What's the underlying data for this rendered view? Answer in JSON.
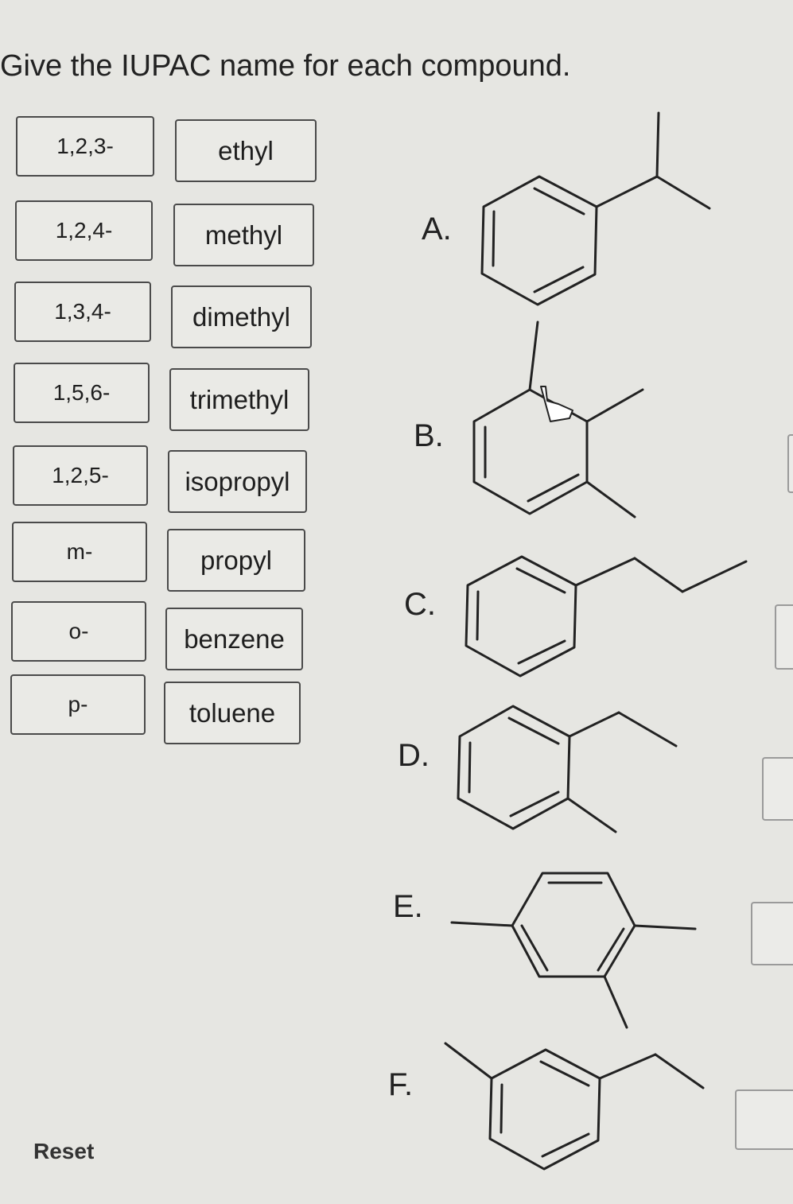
{
  "question": "Give the IUPAC name for each compound.",
  "prefix_tiles": [
    "1,2,3-",
    "1,2,4-",
    "1,3,4-",
    "1,5,6-",
    "1,2,5-",
    "m-",
    "o-",
    "p-"
  ],
  "name_tiles": [
    "ethyl",
    "methyl",
    "dimethyl",
    "trimethyl",
    "isopropyl",
    "propyl",
    "benzene",
    "toluene"
  ],
  "compounds": [
    "A.",
    "B.",
    "C.",
    "D.",
    "E.",
    "F."
  ],
  "reset_label": "Reset",
  "icons": {
    "drag_cursor": "hand-pointer-icon"
  }
}
